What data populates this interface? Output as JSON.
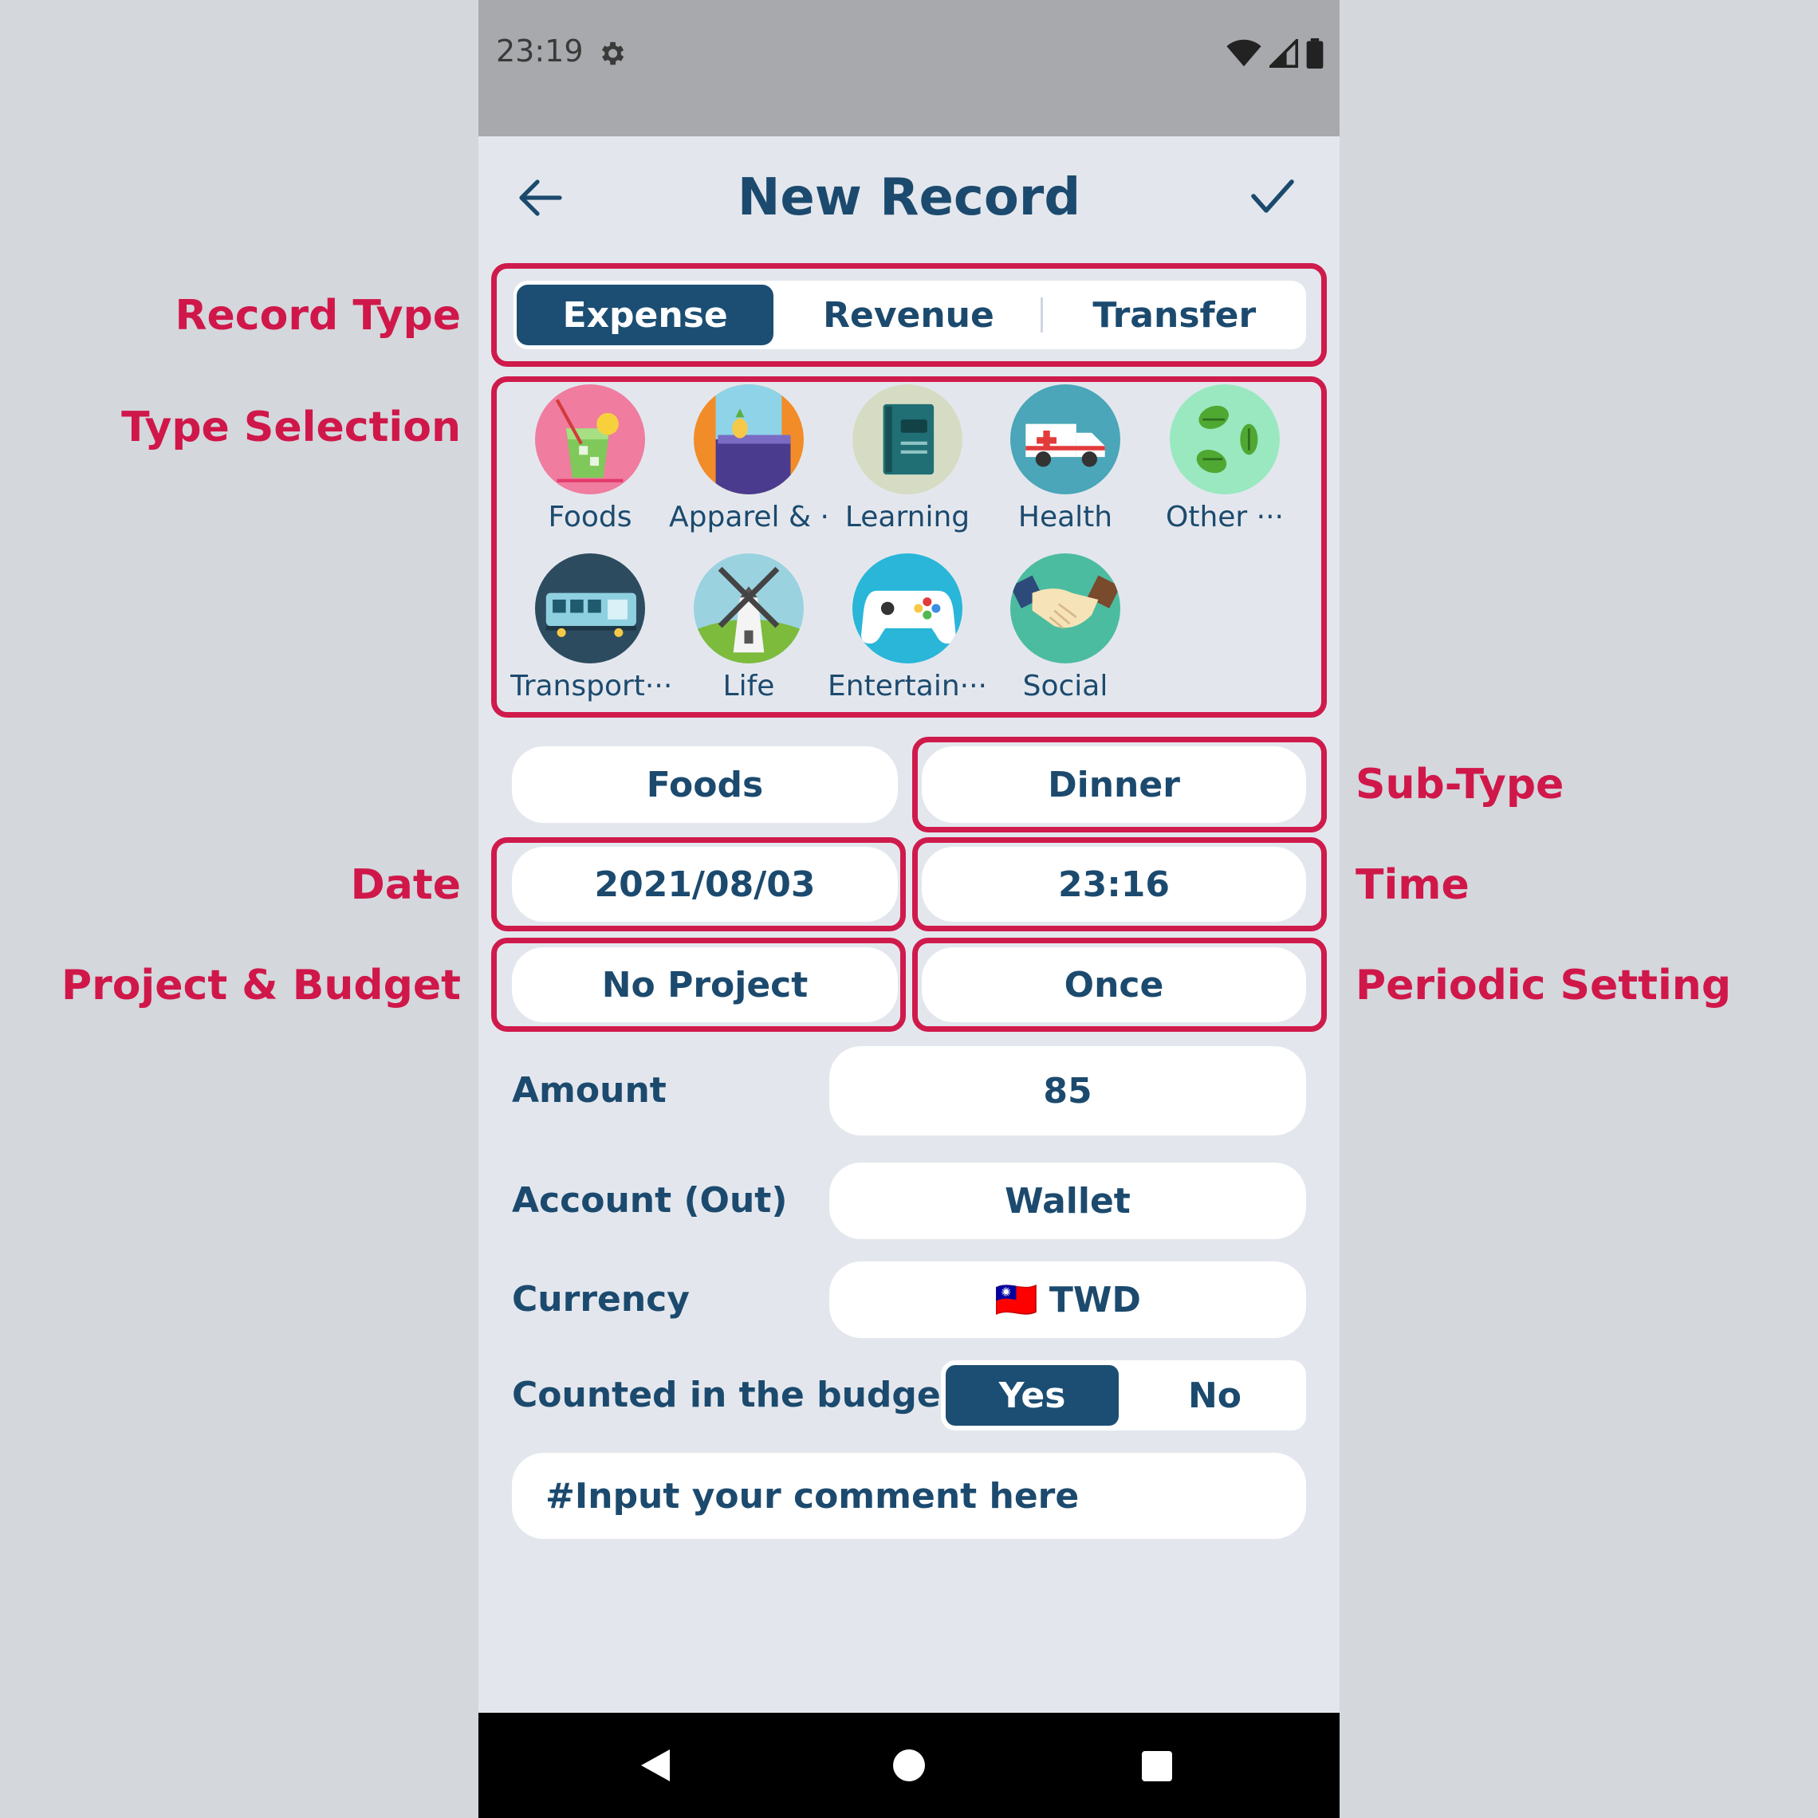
{
  "annotations": {
    "record_type": "Record Type",
    "type_selection": "Type Selection",
    "sub_type": "Sub-Type",
    "date": "Date",
    "time": "Time",
    "project_budget": "Project & Budget",
    "periodic_setting": "Periodic Setting"
  },
  "status_bar": {
    "time": "23:19"
  },
  "header": {
    "title": "New Record"
  },
  "record_type": {
    "tabs": [
      "Expense",
      "Revenue",
      "Transfer"
    ],
    "selected": "Expense"
  },
  "categories": [
    {
      "label": "Foods",
      "icon": "drink-icon"
    },
    {
      "label": "Apparel & ···",
      "icon": "clothes-icon"
    },
    {
      "label": "Learning",
      "icon": "book-icon"
    },
    {
      "label": "Health",
      "icon": "ambulance-icon"
    },
    {
      "label": "Other ···",
      "icon": "leaves-icon"
    },
    {
      "label": "Transport···",
      "icon": "bus-icon"
    },
    {
      "label": "Life",
      "icon": "windmill-icon"
    },
    {
      "label": "Entertain···",
      "icon": "gamepad-icon"
    },
    {
      "label": "Social",
      "icon": "handshake-icon"
    }
  ],
  "fields": {
    "category": "Foods",
    "sub_type": "Dinner",
    "date": "2021/08/03",
    "time": "23:16",
    "project": "No Project",
    "periodic": "Once"
  },
  "form": {
    "amount_label": "Amount",
    "amount_value": "85",
    "account_label": "Account (Out)",
    "account_value": "Wallet",
    "currency_label": "Currency",
    "currency_flag": "🇹🇼",
    "currency_value": "TWD",
    "budget_label": "Counted in the budget",
    "budget_yes": "Yes",
    "budget_no": "No",
    "budget_selected": "Yes",
    "comment_placeholder": "#Input your comment here"
  },
  "colors": {
    "accent": "#1c4e73",
    "annotation": "#cf1a4c",
    "background": "#e3e7ed"
  }
}
